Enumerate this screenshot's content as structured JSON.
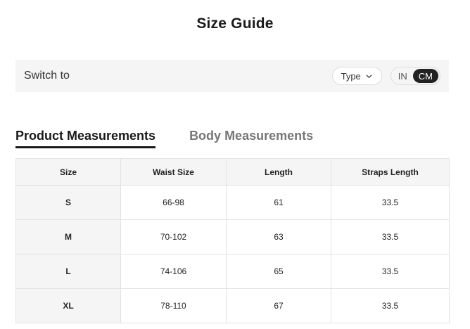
{
  "title": "Size Guide",
  "switch_bar": {
    "label": "Switch to",
    "type_select": "Type",
    "units": [
      "IN",
      "CM"
    ],
    "active_unit": "CM"
  },
  "tabs": [
    {
      "label": "Product Measurements",
      "active": true
    },
    {
      "label": "Body Measurements",
      "active": false
    }
  ],
  "table": {
    "headers": [
      "Size",
      "Waist Size",
      "Length",
      "Straps Length"
    ],
    "rows": [
      [
        "S",
        "66-98",
        "61",
        "33.5"
      ],
      [
        "M",
        "70-102",
        "63",
        "33.5"
      ],
      [
        "L",
        "74-106",
        "65",
        "33.5"
      ],
      [
        "XL",
        "78-110",
        "67",
        "33.5"
      ]
    ]
  }
}
